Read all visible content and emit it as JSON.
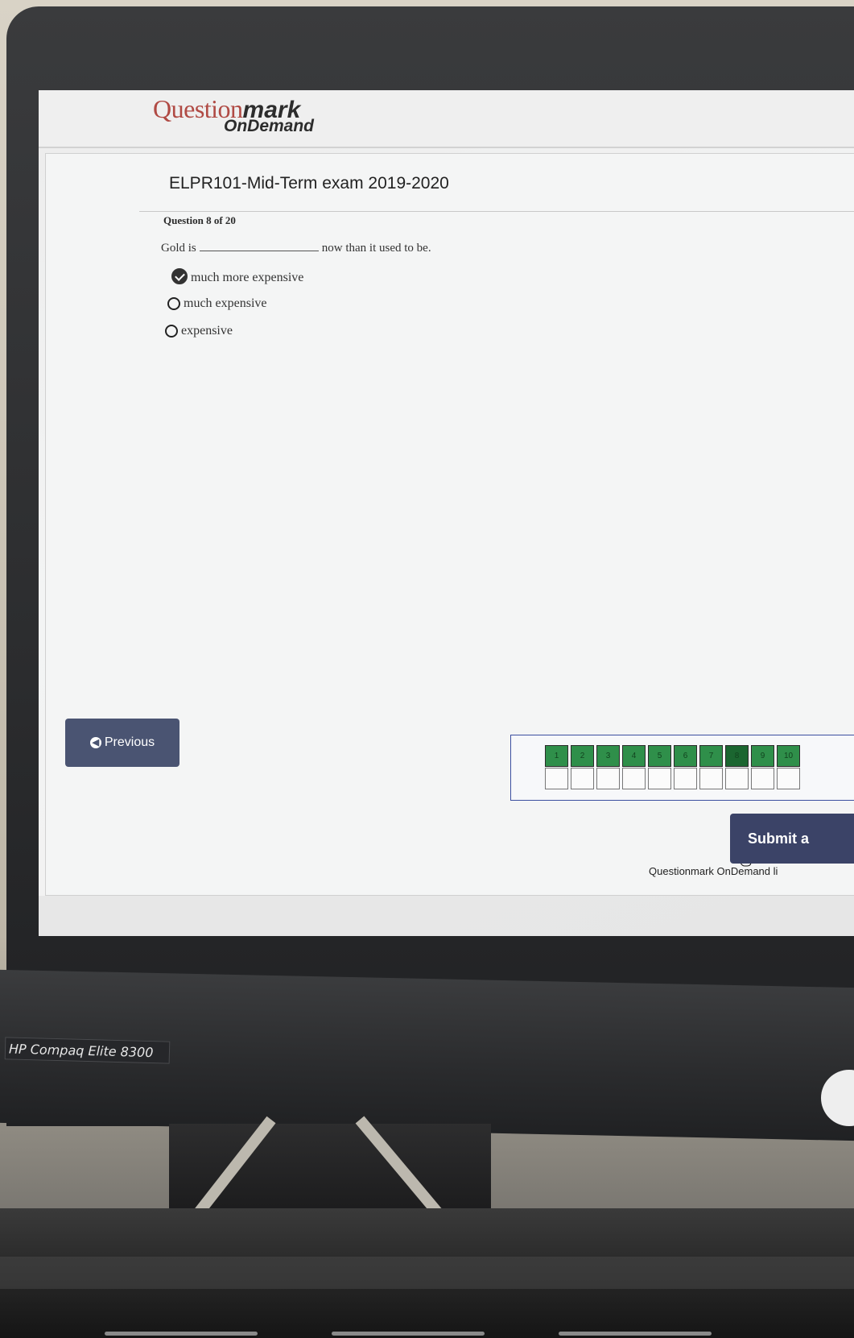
{
  "app": {
    "brand_main": "Question",
    "brand_mark": "mark",
    "brand_sub": "OnDemand"
  },
  "exam": {
    "title": "ELPR101-Mid-Term exam 2019-2020",
    "question_label": "Question 8  of 20"
  },
  "question": {
    "stem_before": "Gold is",
    "stem_after": "now than it used to be.",
    "choices": [
      {
        "label": "much more expensive",
        "selected": true
      },
      {
        "label": "much expensive",
        "selected": false
      },
      {
        "label": "expensive",
        "selected": false
      }
    ]
  },
  "navigation": {
    "previous_label": "Previous",
    "question_numbers": [
      "1",
      "2",
      "3",
      "4",
      "5",
      "6",
      "7",
      "8",
      "9",
      "10"
    ],
    "current_question": 8,
    "submit_label": "Submit a",
    "footer": "Questionmark OnDemand li"
  },
  "hardware": {
    "model_label": "HP Compaq Elite 8300"
  },
  "colors": {
    "brand_red": "#b04a44",
    "answered_green": "#2f8f4a",
    "button_navy": "#4a5472",
    "nav_border": "#3c4fa0"
  }
}
